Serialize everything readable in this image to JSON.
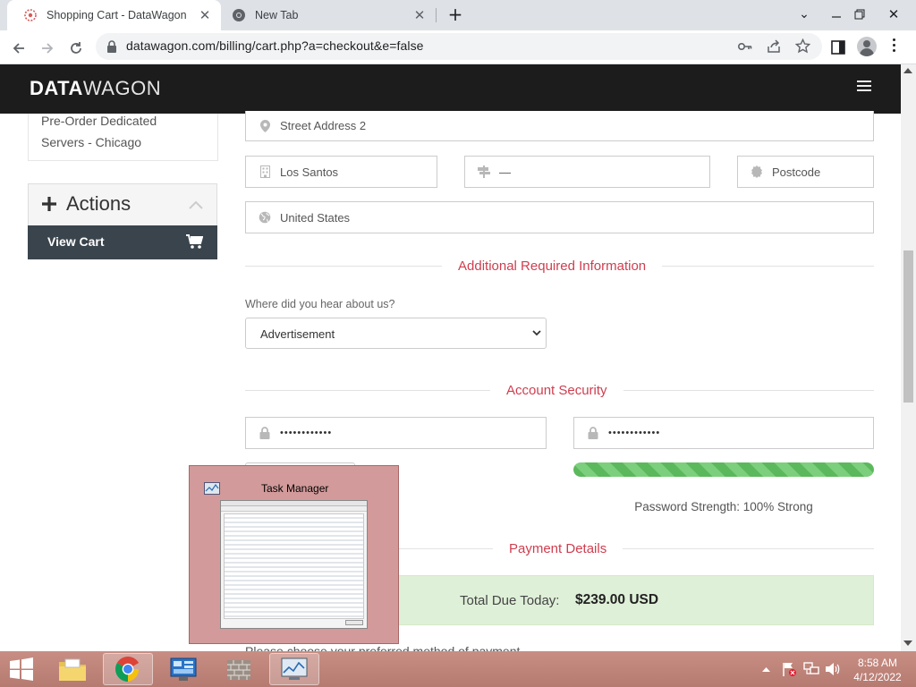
{
  "browser": {
    "tabs": [
      {
        "title": "Shopping Cart - DataWagon",
        "active": true
      },
      {
        "title": "New Tab",
        "active": false
      }
    ],
    "url": "datawagon.com/billing/cart.php?a=checkout&e=false"
  },
  "site": {
    "logo_bold": "DATA",
    "logo_thin": "WAGON"
  },
  "sidebar": {
    "item_line1": "Pre-Order Dedicated",
    "item_line2": "Servers - Chicago",
    "actions_title": "Actions",
    "view_cart_label": "View Cart"
  },
  "form": {
    "street2_placeholder": "Street Address 2",
    "city_value": "Los Santos",
    "state_value": "—",
    "postcode_placeholder": "Postcode",
    "country_value": "United States"
  },
  "additional": {
    "title": "Additional Required Information",
    "question": "Where did you hear about us?",
    "selected": "Advertisement"
  },
  "security": {
    "title": "Account Security",
    "password_mask": "••••••••••••",
    "confirm_mask": "••••••••••••",
    "strength_text": "Password Strength: 100% Strong",
    "strength_percent": 100
  },
  "payment": {
    "title": "Payment Details",
    "total_label": "Total Due Today:",
    "total_value": "$239.00 USD",
    "method_prompt": "Please choose your preferred method of payment."
  },
  "popup": {
    "title": "Task Manager"
  },
  "taskbar": {
    "time": "8:58 AM",
    "date": "4/12/2022"
  },
  "colors": {
    "accent": "#cf3e4f",
    "header_bg": "#1c1c1c",
    "view_cart_bg": "#3a444c",
    "strength_green": "#5cb85c",
    "total_bg": "#dff0d8"
  }
}
